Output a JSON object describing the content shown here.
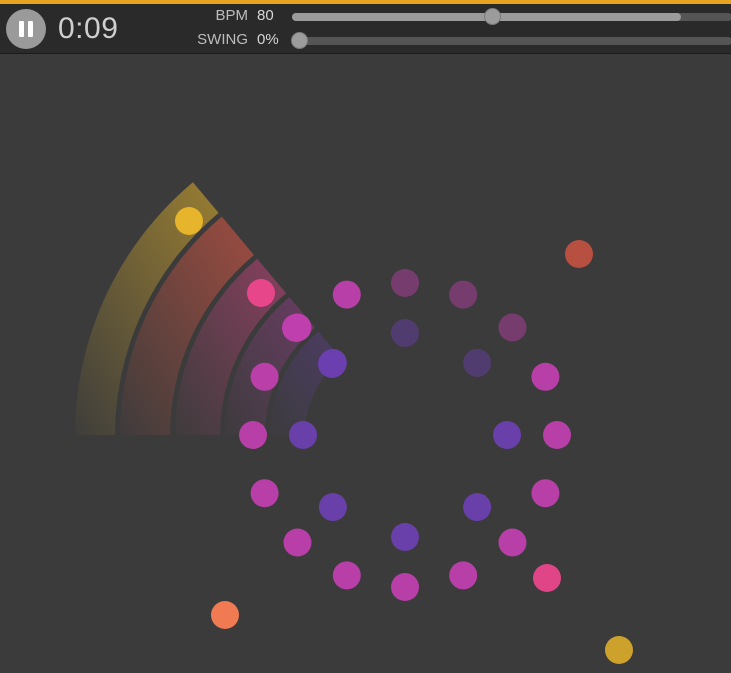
{
  "playback": {
    "state": "playing",
    "control_icon": "pause-icon",
    "time": "0:09"
  },
  "controls": {
    "bpm": {
      "label": "BPM",
      "value": "80",
      "fraction": 0.46
    },
    "swing": {
      "label": "SWING",
      "value": "0%",
      "fraction": 0.0
    }
  },
  "colors": {
    "accent_bar": "#e8a321",
    "background": "#3b3b3b",
    "toolbar": "#2a2a2a",
    "yellow": "#e6b52b",
    "red_orange": "#ee5a45",
    "pink": "#e8468b",
    "magenta": "#c03fae",
    "purple": "#6c3fb0",
    "orange": "#f07a52"
  }
}
